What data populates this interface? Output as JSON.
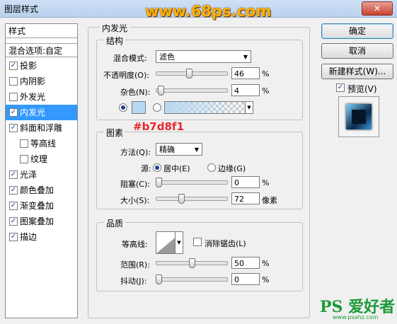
{
  "window": {
    "title": "图层样式",
    "close_glyph": "✕"
  },
  "watermark_top": "www.68ps.com",
  "style_list": {
    "header": "样式",
    "blend_options": "混合选项:自定",
    "items": [
      {
        "label": "投影",
        "checked": true
      },
      {
        "label": "内阴影",
        "checked": false
      },
      {
        "label": "外发光",
        "checked": false
      },
      {
        "label": "内发光",
        "checked": true,
        "selected": true
      },
      {
        "label": "斜面和浮雕",
        "checked": true
      },
      {
        "label": "等高线",
        "checked": false,
        "indent": true
      },
      {
        "label": "纹理",
        "checked": false,
        "indent": true
      },
      {
        "label": "光泽",
        "checked": true
      },
      {
        "label": "颜色叠加",
        "checked": true
      },
      {
        "label": "渐变叠加",
        "checked": true
      },
      {
        "label": "图案叠加",
        "checked": true
      },
      {
        "label": "描边",
        "checked": true
      }
    ]
  },
  "inner_glow": {
    "title": "内发光",
    "structure": {
      "title": "结构",
      "blend_mode_label": "混合模式:",
      "blend_mode_value": "滤色",
      "opacity_label": "不透明度(O):",
      "opacity_value": "46",
      "noise_label": "杂色(N):",
      "noise_value": "4",
      "percent": "%",
      "glow_color": "#b7d8f1"
    },
    "elements": {
      "title": "图素",
      "color_annotation": "#b7d8f1",
      "technique_label": "方法(Q):",
      "technique_value": "精确",
      "source_label": "源:",
      "source_center": "居中(E)",
      "source_edge": "边缘(G)",
      "choke_label": "阻塞(C):",
      "choke_value": "0",
      "size_label": "大小(S):",
      "size_value": "72",
      "pixels": "像素"
    },
    "quality": {
      "title": "品质",
      "contour_label": "等高线:",
      "anti_alias_label": "消除锯齿(L)",
      "range_label": "范围(R):",
      "range_value": "50",
      "jitter_label": "抖动(J):",
      "jitter_value": "0"
    }
  },
  "buttons": {
    "ok": "确定",
    "cancel": "取消",
    "new_style": "新建样式(W)...",
    "preview_label": "预览(V)"
  },
  "watermark_bottom": "PS 爱好者",
  "watermark_url": "www.psahz.com",
  "colors": {
    "accent_selection": "#3399ff",
    "annotation_red": "#e8262a",
    "watermark_orange": "#ffb100",
    "watermark_green": "#1d9b3a"
  }
}
